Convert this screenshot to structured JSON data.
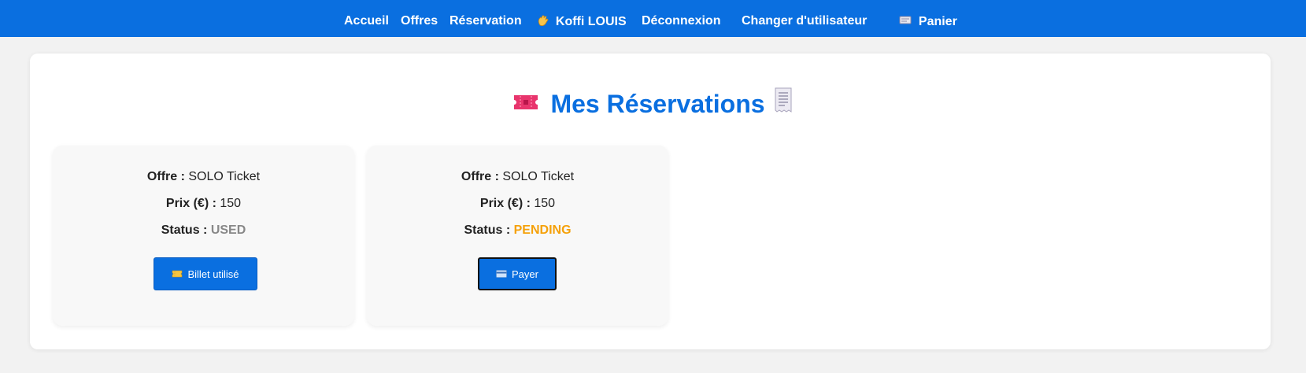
{
  "nav": {
    "accueil": "Accueil",
    "offres": "Offres",
    "reservation": "Réservation",
    "user": "Koffi LOUIS",
    "deconnexion": "Déconnexion",
    "changer": "Changer d'utilisateur",
    "panier": "Panier",
    "user_icon": "waving-hand-icon",
    "panier_icon": "cart-icon"
  },
  "page": {
    "title": "Mes Réservations",
    "left_icon": "ticket-icon",
    "right_icon": "receipt-icon"
  },
  "labels": {
    "offre": "Offre :",
    "prix": "Prix (€) :",
    "status": "Status :"
  },
  "reservations": [
    {
      "offre": "SOLO Ticket",
      "prix": "150",
      "status": "USED",
      "status_color": "#888888",
      "button": "Billet utilisé",
      "button_icon": "ticket-icon"
    },
    {
      "offre": "SOLO Ticket",
      "prix": "150",
      "status": "PENDING",
      "status_color": "#f5a10a",
      "button": "Payer",
      "button_icon": "credit-card-icon"
    }
  ],
  "colors": {
    "brand": "#0a6fe0",
    "used": "#888888",
    "pending": "#f5a10a"
  }
}
